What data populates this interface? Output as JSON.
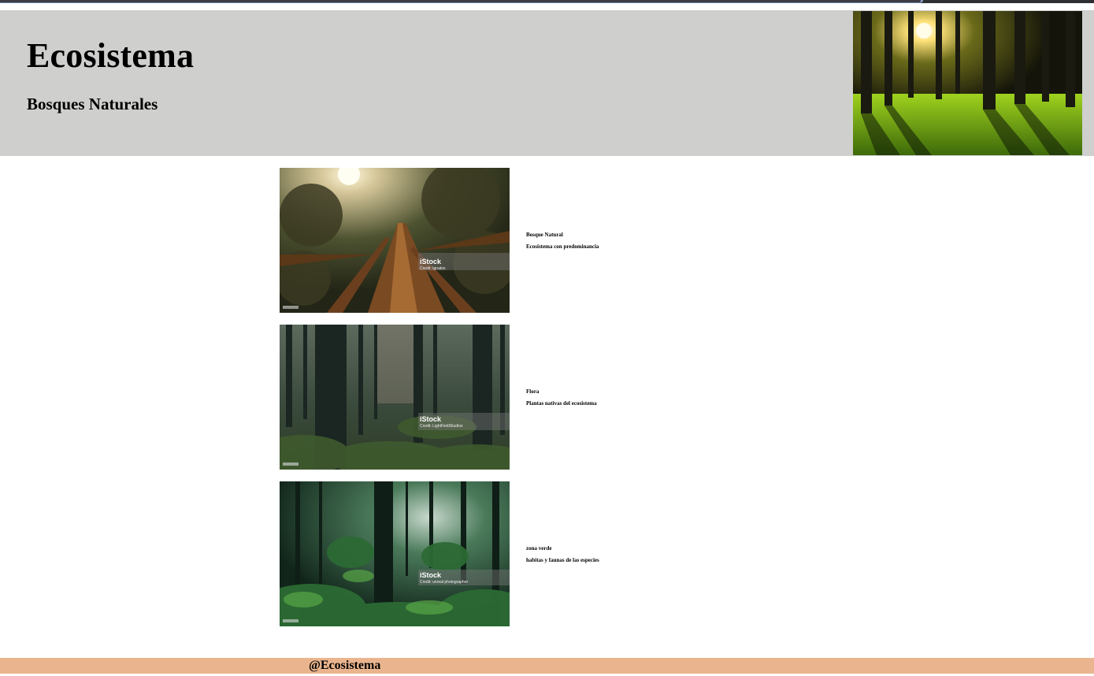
{
  "header": {
    "title": "Ecosistema",
    "subtitle": "Bosques Naturales",
    "image_icon": "sunlit-forest-photo"
  },
  "cards": [
    {
      "line1": "Bosque Natural",
      "line2": "Ecosistema con predominancia",
      "watermark_logo": "iStock",
      "watermark_credit": "Credit: Ignatos",
      "image_icon": "tall-trees-from-below-photo"
    },
    {
      "line1": "Flora",
      "line2": "Plantas nativas del ecosistema",
      "watermark_logo": "iStock",
      "watermark_credit": "Credit: LightFieldStudios",
      "image_icon": "dark-forest-undergrowth-photo"
    },
    {
      "line1": "zona verde",
      "line2": "habitas y faunas de las especies",
      "watermark_logo": "iStock",
      "watermark_credit": "Credit: unreal photographer",
      "image_icon": "misty-green-forest-photo"
    }
  ],
  "footer": {
    "handle": "@Ecosistema"
  },
  "colors": {
    "header_bg": "#cfcfcd",
    "footer_bg": "#eab58e",
    "page_bg": "#ffffff"
  }
}
